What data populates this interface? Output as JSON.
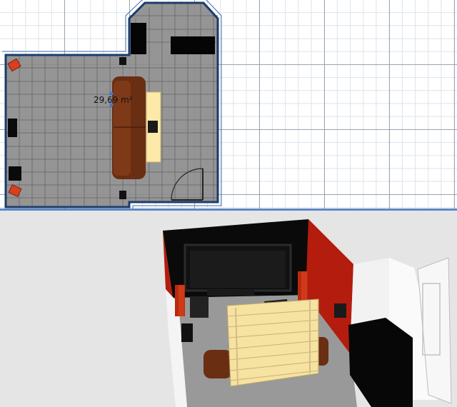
{
  "plan": {
    "room_area_label": "29,69 m²"
  },
  "colors": {
    "floor_plan": "#8c8c8c",
    "wall_outline": "#1c3b6b",
    "sofa": "#6a2e12",
    "shelf": "#fde9a8",
    "accent_wall": "#b41c0e",
    "screen": "#141414",
    "view3d_background": "#e5e5e5"
  }
}
